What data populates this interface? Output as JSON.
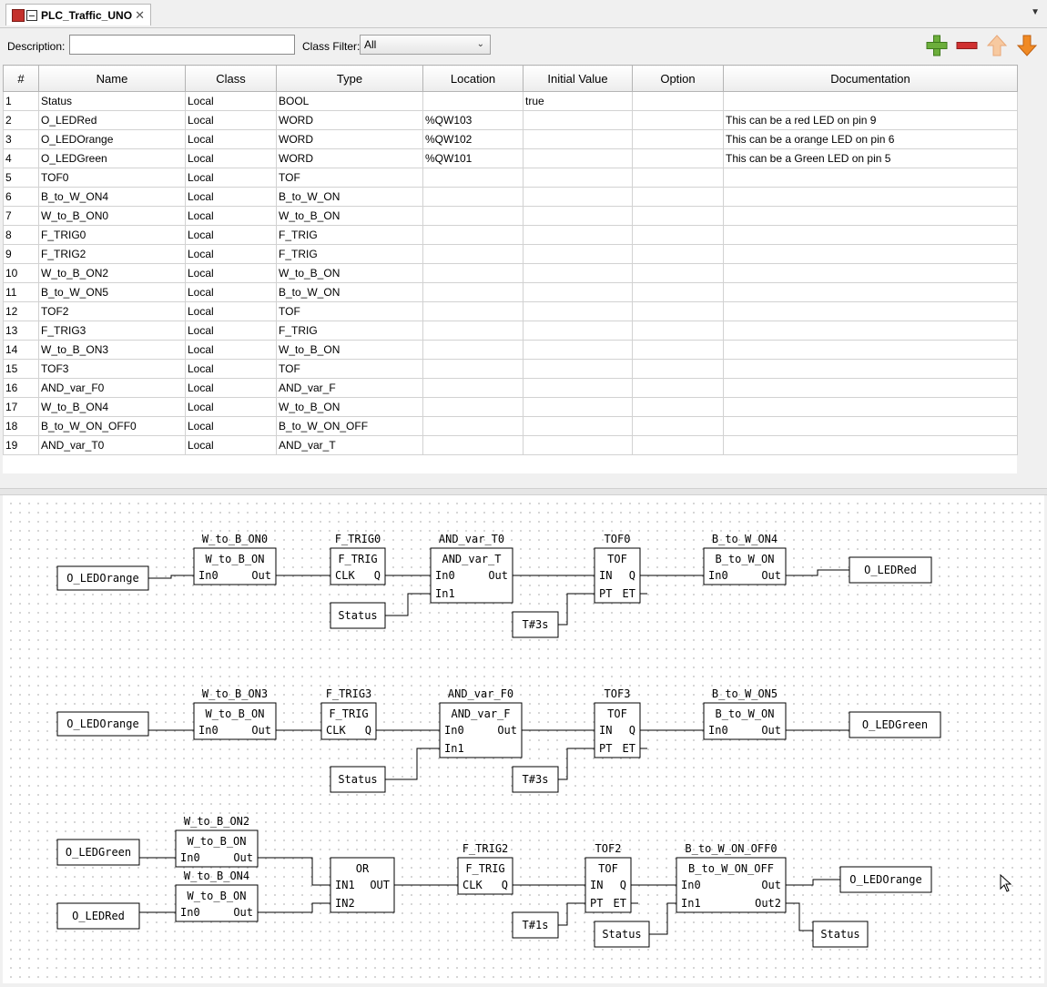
{
  "tab": {
    "title": "PLC_Traffic_UNO",
    "close": "✕",
    "menu_icon": "chevron-down-icon"
  },
  "filter": {
    "description_label": "Description:",
    "description_value": "",
    "class_filter_label": "Class Filter:",
    "class_filter_value": "All"
  },
  "toolbar": {
    "add_icon": "plus-icon",
    "remove_icon": "minus-icon",
    "up_icon": "arrow-up-icon",
    "down_icon": "arrow-down-icon",
    "colors": {
      "add": "#6cae3b",
      "remove": "#d03030",
      "up": "#f7c9a0",
      "down": "#f08a24"
    }
  },
  "table": {
    "columns": [
      "#",
      "Name",
      "Class",
      "Type",
      "Location",
      "Initial Value",
      "Option",
      "Documentation"
    ],
    "rows": [
      [
        "1",
        "Status",
        "Local",
        "BOOL",
        "",
        "true",
        "",
        ""
      ],
      [
        "2",
        "O_LEDRed",
        "Local",
        "WORD",
        "%QW103",
        "",
        "",
        "This can be a red LED on pin 9"
      ],
      [
        "3",
        "O_LEDOrange",
        "Local",
        "WORD",
        "%QW102",
        "",
        "",
        "This can be a orange LED on pin 6"
      ],
      [
        "4",
        "O_LEDGreen",
        "Local",
        "WORD",
        "%QW101",
        "",
        "",
        "This can be a Green LED on pin 5"
      ],
      [
        "5",
        "TOF0",
        "Local",
        "TOF",
        "",
        "",
        "",
        ""
      ],
      [
        "6",
        "B_to_W_ON4",
        "Local",
        "B_to_W_ON",
        "",
        "",
        "",
        ""
      ],
      [
        "7",
        "W_to_B_ON0",
        "Local",
        "W_to_B_ON",
        "",
        "",
        "",
        ""
      ],
      [
        "8",
        "F_TRIG0",
        "Local",
        "F_TRIG",
        "",
        "",
        "",
        ""
      ],
      [
        "9",
        "F_TRIG2",
        "Local",
        "F_TRIG",
        "",
        "",
        "",
        ""
      ],
      [
        "10",
        "W_to_B_ON2",
        "Local",
        "W_to_B_ON",
        "",
        "",
        "",
        ""
      ],
      [
        "11",
        "B_to_W_ON5",
        "Local",
        "B_to_W_ON",
        "",
        "",
        "",
        ""
      ],
      [
        "12",
        "TOF2",
        "Local",
        "TOF",
        "",
        "",
        "",
        ""
      ],
      [
        "13",
        "F_TRIG3",
        "Local",
        "F_TRIG",
        "",
        "",
        "",
        ""
      ],
      [
        "14",
        "W_to_B_ON3",
        "Local",
        "W_to_B_ON",
        "",
        "",
        "",
        ""
      ],
      [
        "15",
        "TOF3",
        "Local",
        "TOF",
        "",
        "",
        "",
        ""
      ],
      [
        "16",
        "AND_var_F0",
        "Local",
        "AND_var_F",
        "",
        "",
        "",
        ""
      ],
      [
        "17",
        "W_to_B_ON4",
        "Local",
        "W_to_B_ON",
        "",
        "",
        "",
        ""
      ],
      [
        "18",
        "B_to_W_ON_OFF0",
        "Local",
        "B_to_W_ON_OFF",
        "",
        "",
        "",
        ""
      ],
      [
        "19",
        "AND_var_T0",
        "Local",
        "AND_var_T",
        "",
        "",
        "",
        ""
      ]
    ]
  },
  "diagram": {
    "variables": [
      "O_LEDOrange",
      "Status",
      "T#3s",
      "O_LEDRed",
      "O_LEDOrange",
      "Status",
      "T#3s",
      "O_LEDGreen",
      "O_LEDGreen",
      "O_LEDRed",
      "T#1s",
      "Status",
      "O_LEDOrange",
      "Status"
    ],
    "blocks": [
      {
        "instance": "W_to_B_ON0",
        "type": "W_to_B_ON",
        "inputs": [
          "In0"
        ],
        "outputs": [
          "Out"
        ]
      },
      {
        "instance": "F_TRIG0",
        "type": "F_TRIG",
        "inputs": [
          "CLK"
        ],
        "outputs": [
          "Q"
        ]
      },
      {
        "instance": "AND_var_T0",
        "type": "AND_var_T",
        "inputs": [
          "In0",
          "In1"
        ],
        "outputs": [
          "Out"
        ]
      },
      {
        "instance": "TOF0",
        "type": "TOF",
        "inputs": [
          "IN",
          "PT"
        ],
        "outputs": [
          "Q",
          "ET"
        ]
      },
      {
        "instance": "B_to_W_ON4",
        "type": "B_to_W_ON",
        "inputs": [
          "In0"
        ],
        "outputs": [
          "Out"
        ]
      },
      {
        "instance": "W_to_B_ON3",
        "type": "W_to_B_ON",
        "inputs": [
          "In0"
        ],
        "outputs": [
          "Out"
        ]
      },
      {
        "instance": "F_TRIG3",
        "type": "F_TRIG",
        "inputs": [
          "CLK"
        ],
        "outputs": [
          "Q"
        ]
      },
      {
        "instance": "AND_var_F0",
        "type": "AND_var_F",
        "inputs": [
          "In0",
          "In1"
        ],
        "outputs": [
          "Out"
        ]
      },
      {
        "instance": "TOF3",
        "type": "TOF",
        "inputs": [
          "IN",
          "PT"
        ],
        "outputs": [
          "Q",
          "ET"
        ]
      },
      {
        "instance": "B_to_W_ON5",
        "type": "B_to_W_ON",
        "inputs": [
          "In0"
        ],
        "outputs": [
          "Out"
        ]
      },
      {
        "instance": "W_to_B_ON2",
        "type": "W_to_B_ON",
        "inputs": [
          "In0"
        ],
        "outputs": [
          "Out"
        ]
      },
      {
        "instance": "W_to_B_ON4",
        "type": "W_to_B_ON",
        "inputs": [
          "In0"
        ],
        "outputs": [
          "Out"
        ]
      },
      {
        "instance": "",
        "type": "OR",
        "inputs": [
          "IN1",
          "IN2"
        ],
        "outputs": [
          "OUT"
        ]
      },
      {
        "instance": "F_TRIG2",
        "type": "F_TRIG",
        "inputs": [
          "CLK"
        ],
        "outputs": [
          "Q"
        ]
      },
      {
        "instance": "TOF2",
        "type": "TOF",
        "inputs": [
          "IN",
          "PT"
        ],
        "outputs": [
          "Q",
          "ET"
        ]
      },
      {
        "instance": "B_to_W_ON_OFF0",
        "type": "B_to_W_ON_OFF",
        "inputs": [
          "In0",
          "In1"
        ],
        "outputs": [
          "Out",
          "Out2"
        ]
      }
    ]
  }
}
